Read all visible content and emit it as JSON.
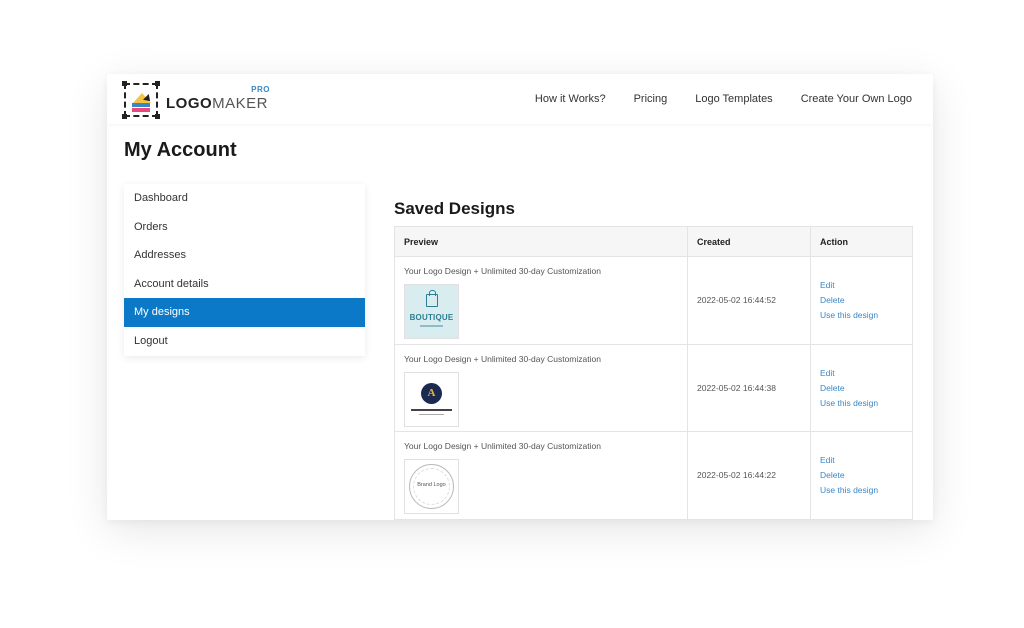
{
  "header": {
    "logo_main": "LOGO",
    "logo_sub": "MAKER",
    "logo_badge": "PRO",
    "nav": [
      "How it Works?",
      "Pricing",
      "Logo Templates",
      "Create Your Own Logo"
    ]
  },
  "page": {
    "title": "My Account"
  },
  "sidebar": {
    "items": [
      {
        "label": "Dashboard",
        "active": false
      },
      {
        "label": "Orders",
        "active": false
      },
      {
        "label": "Addresses",
        "active": false
      },
      {
        "label": "Account details",
        "active": false
      },
      {
        "label": "My designs",
        "active": true
      },
      {
        "label": "Logout",
        "active": false
      }
    ]
  },
  "designs": {
    "title": "Saved Designs",
    "columns": [
      "Preview",
      "Created",
      "Action"
    ],
    "rows": [
      {
        "title": "Your Logo Design + Unlimited 30-day Customization",
        "thumb_icon": "shopping-bag-icon",
        "thumb_text": "BOUTIQUE",
        "created": "2022-05-02 16:44:52",
        "actions": [
          "Edit",
          "Delete",
          "Use this design"
        ]
      },
      {
        "title": "Your Logo Design + Unlimited 30-day Customization",
        "thumb_icon": "letter-a-emblem-icon",
        "thumb_text": "A",
        "created": "2022-05-02 16:44:38",
        "actions": [
          "Edit",
          "Delete",
          "Use this design"
        ]
      },
      {
        "title": "Your Logo Design + Unlimited 30-day Customization",
        "thumb_icon": "circular-badge-icon",
        "thumb_text": "Brand Logo",
        "created": "2022-05-02 16:44:22",
        "actions": [
          "Edit",
          "Delete",
          "Use this design"
        ]
      }
    ]
  },
  "colors": {
    "accent": "#0b79c7",
    "link": "#3a86c8",
    "logo_yellow": "#f4c542",
    "logo_pink": "#e84a7f"
  }
}
